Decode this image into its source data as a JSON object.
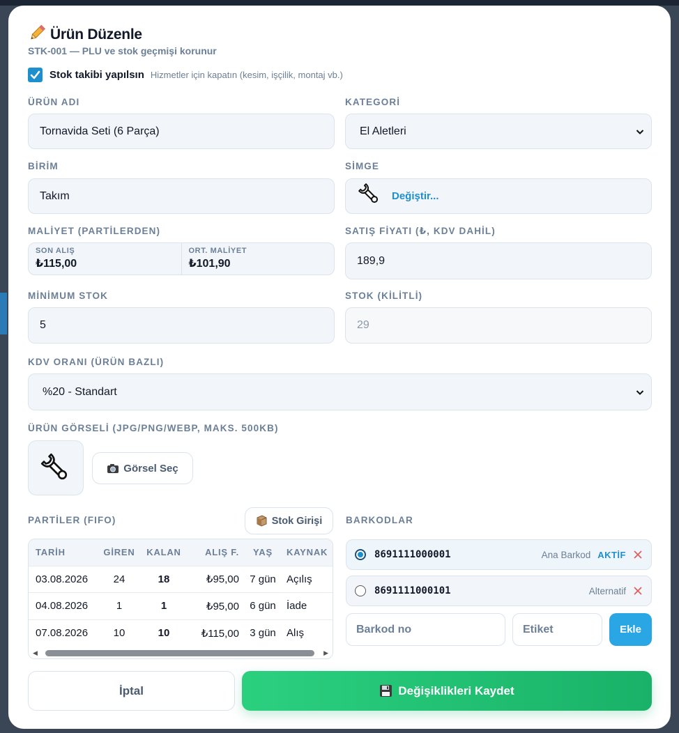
{
  "dialog": {
    "title": "Ürün Düzenle",
    "subtitle": "STK-001 — PLU ve stok geçmişi korunur",
    "title_icon": "pencil-icon"
  },
  "stock_tracking": {
    "checked": true,
    "label": "Stok takibi yapılsın",
    "hint": "Hizmetler için kapatın (kesim, işçilik, montaj vb.)"
  },
  "fields": {
    "name_label": "ÜRÜN ADI",
    "name_value": "Tornavida Seti (6 Parça)",
    "category_label": "KATEGORİ",
    "category_value": "El Aletleri",
    "unit_label": "BİRİM",
    "unit_value": "Takım",
    "icon_label": "SİMGE",
    "icon_change": "Değiştir...",
    "cost_label": "MALİYET (PARTİLERDEN)",
    "last_purchase_label": "SON ALIŞ",
    "last_purchase_value": "₺115,00",
    "avg_cost_label": "ORT. MALİYET",
    "avg_cost_value": "₺101,90",
    "price_label": "SATIŞ FİYATI (₺, KDV DAHİL)",
    "price_value": "189,9",
    "min_stock_label": "MİNİMUM STOK",
    "min_stock_value": "5",
    "stock_label": "STOK (KİLİTLİ)",
    "stock_value": "29",
    "vat_label": "KDV ORANI (ÜRÜN BAZLI)",
    "vat_value": "%20 - Standart",
    "image_label": "ÜRÜN GÖRSELİ (JPG/PNG/WEBP, MAKS. 500KB)",
    "image_button": "Görsel Seç"
  },
  "batches": {
    "title": "PARTİLER (FIFO)",
    "stock_entry_button": "Stok Girişi",
    "columns": [
      "TARİH",
      "GİREN",
      "KALAN",
      "ALIŞ F.",
      "YAŞ",
      "KAYNAK"
    ],
    "rows": [
      [
        "03.08.2026",
        "24",
        "18",
        "₺95,00",
        "7 gün",
        "Açılış"
      ],
      [
        "04.08.2026",
        "1",
        "1",
        "₺95,00",
        "6 gün",
        "İade"
      ],
      [
        "07.08.2026",
        "10",
        "10",
        "₺115,00",
        "3 gün",
        "Alış"
      ]
    ]
  },
  "barcodes": {
    "title": "BARKODLAR",
    "items": [
      {
        "code": "8691111000001",
        "tag": "Ana Barkod",
        "status": "AKTİF",
        "selected": true
      },
      {
        "code": "8691111000101",
        "tag": "Alternatif",
        "status": "",
        "selected": false
      }
    ],
    "code_placeholder": "Barkod no",
    "label_placeholder": "Etiket",
    "add_button": "Ekle"
  },
  "footer": {
    "cancel": "İptal",
    "save": "Değişiklikleri Kaydet"
  },
  "colors": {
    "accent": "#1d8fcf",
    "save": "#22c374",
    "delete": "#e05a5a"
  }
}
